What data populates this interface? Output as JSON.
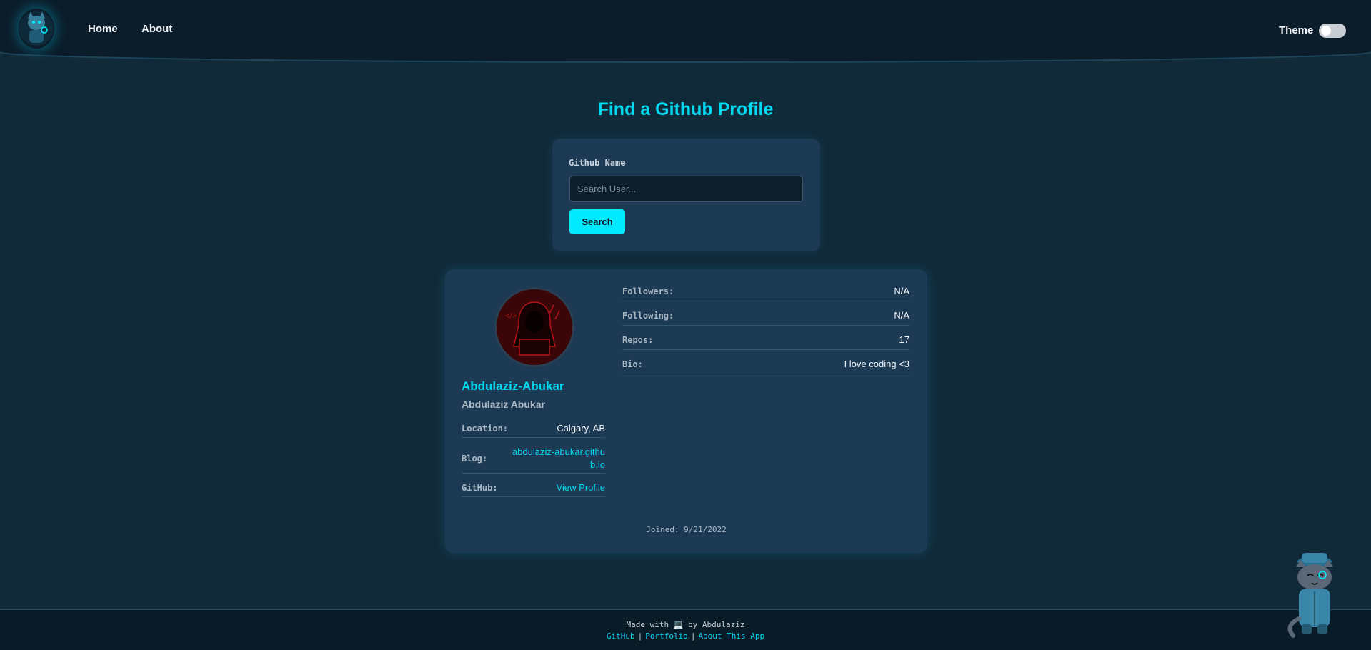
{
  "nav": {
    "logo_icon": "detective-cat-logo-icon",
    "home": "Home",
    "about": "About",
    "theme_label": "Theme"
  },
  "title": "Find a Github Profile",
  "search": {
    "label": "Github Name",
    "placeholder": "Search User...",
    "button": "Search"
  },
  "profile": {
    "username": "Abdulaziz-Abukar",
    "fullname": "Abdulaziz Abukar",
    "location_label": "Location:",
    "location": "Calgary, AB",
    "blog_label": "Blog:",
    "blog": "abdulaziz-abukar.github.io",
    "github_label": "GitHub:",
    "github_link": "View Profile",
    "followers_label": "Followers:",
    "followers": "N/A",
    "following_label": "Following:",
    "following": "N/A",
    "repos_label": "Repos:",
    "repos": "17",
    "bio_label": "Bio:",
    "bio": "I love coding <3",
    "joined": "Joined: 9/21/2022"
  },
  "footer": {
    "made_with_prefix": "Made with",
    "laptop_icon": "💻",
    "made_with_suffix": "by Abdulaziz",
    "links": [
      "GitHub",
      "Portfolio",
      "About This App"
    ],
    "separator": "|"
  },
  "colors": {
    "accent": "#00eaff",
    "background": "#112a3a",
    "card": "#1d3a54",
    "navbar": "#0b1c2a"
  }
}
